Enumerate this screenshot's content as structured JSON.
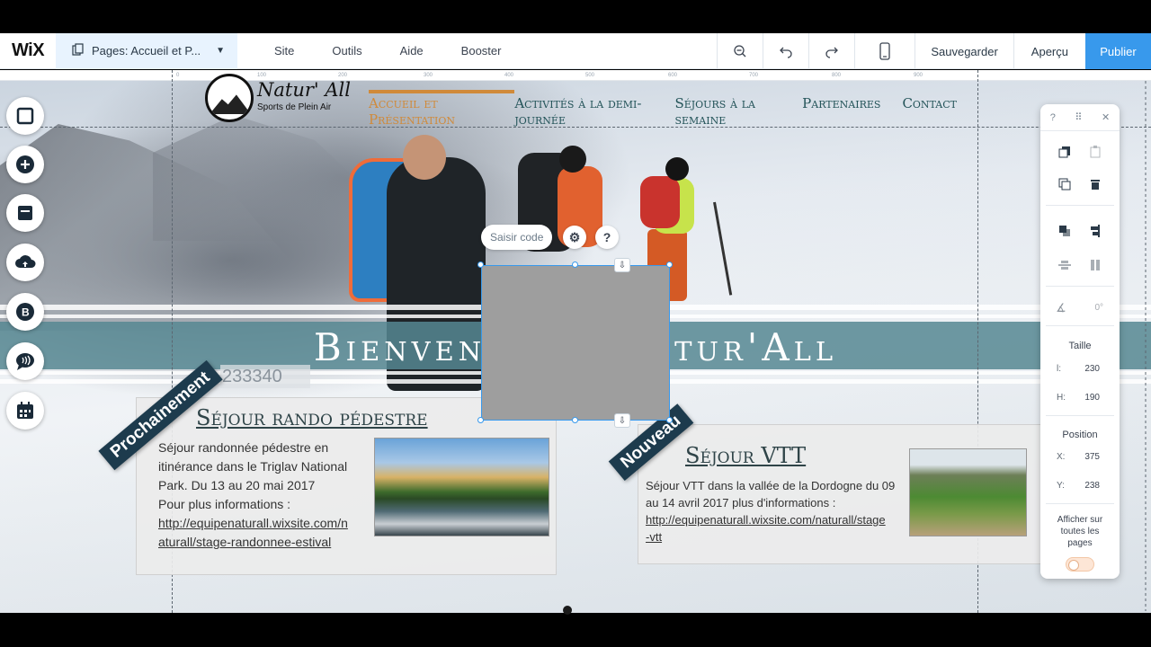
{
  "topbar": {
    "logo": "WiX",
    "pages_label": "Pages: Accueil et P...",
    "menu": [
      "Site",
      "Outils",
      "Aide",
      "Booster"
    ],
    "save": "Sauvegarder",
    "preview": "Aperçu",
    "publish": "Publier"
  },
  "ruler": [
    "0",
    "100",
    "200",
    "300",
    "400",
    "500",
    "600",
    "700",
    "800",
    "900"
  ],
  "site": {
    "logo_title": "Natur' All",
    "logo_subtitle": "Sports de Plein Air",
    "nav": [
      "Accueil et Présentation",
      "Activités à la demi-journée",
      "Séjours à la semaine",
      "Partenaires",
      "Contact"
    ],
    "banner_left": "Bienven",
    "banner_right": "tur'All",
    "coord_readout": "233340"
  },
  "post1": {
    "ribbon": "Prochainement",
    "title": "Séjour rando pédestre",
    "line1": "Séjour randonnée pédestre en",
    "line2": "itinérance dans le Triglav National",
    "line3": "Park. Du 13 au 20 mai 2017",
    "line4": "Pour plus informations :",
    "link1": "http://equipenaturall.wixsite.com/n",
    "link2": "aturall/stage-randonnee-estival"
  },
  "post2": {
    "ribbon": "Nouveau",
    "title": "Séjour VTT",
    "line1": "Séjour VTT dans la vallée de la Dordogne du 09",
    "line2": "au 14 avril 2017 plus d'informations :",
    "link1": "http://equipenaturall.wixsite.com/naturall/stage",
    "link2": "-vtt"
  },
  "selection": {
    "chip": "Saisir code"
  },
  "panel": {
    "help": "?",
    "size_label": "Taille",
    "width_key": "l:",
    "width_val": "230",
    "height_key": "H:",
    "height_val": "190",
    "position_label": "Position",
    "x_key": "X:",
    "x_val": "375",
    "y_key": "Y:",
    "y_val": "238",
    "rotation": "0°",
    "show_all_l1": "Afficher sur",
    "show_all_l2": "toutes les",
    "show_all_l3": "pages"
  },
  "colors": {
    "accent": "#3899ec",
    "nav_active": "#d08a3a",
    "banner": "#568792",
    "ribbon": "#1d3b4d"
  }
}
